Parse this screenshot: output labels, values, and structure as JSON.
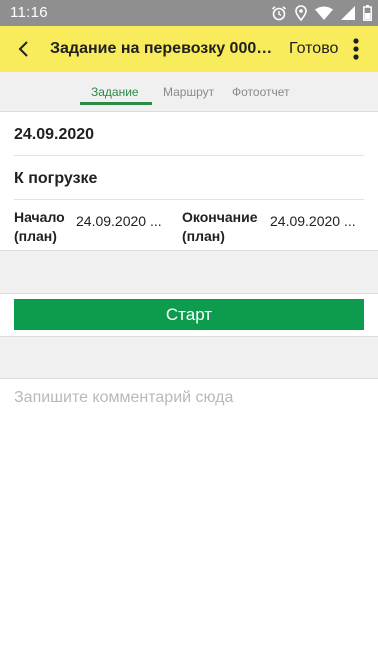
{
  "status_bar": {
    "time": "11:16",
    "icons": [
      "alarm-icon",
      "location-icon",
      "wifi-icon",
      "signal-icon",
      "battery-icon"
    ]
  },
  "toolbar": {
    "title": "Задание на перевозку 000000...",
    "done_label": "Готово",
    "icons": [
      "back-arrow-icon",
      "more-vertical-icon"
    ],
    "background": "#f8ec5c"
  },
  "tabs": [
    {
      "label": "Задание",
      "active": true
    },
    {
      "label": "Маршрут",
      "active": false
    },
    {
      "label": "Фотоотчет",
      "active": false
    }
  ],
  "task": {
    "date": "24.09.2020",
    "status": "К погрузке",
    "start_label_line1": "Начало",
    "start_label_line2": "(план)",
    "start_value": "24.09.2020 ...",
    "end_label_line1": "Окончание",
    "end_label_line2": "(план)",
    "end_value": "24.09.2020 ..."
  },
  "start_button": {
    "label": "Старт",
    "color": "#0d9b4d"
  },
  "comment": {
    "placeholder": "Запишите комментарий сюда",
    "value": ""
  },
  "accent_color": "#2a8b45"
}
